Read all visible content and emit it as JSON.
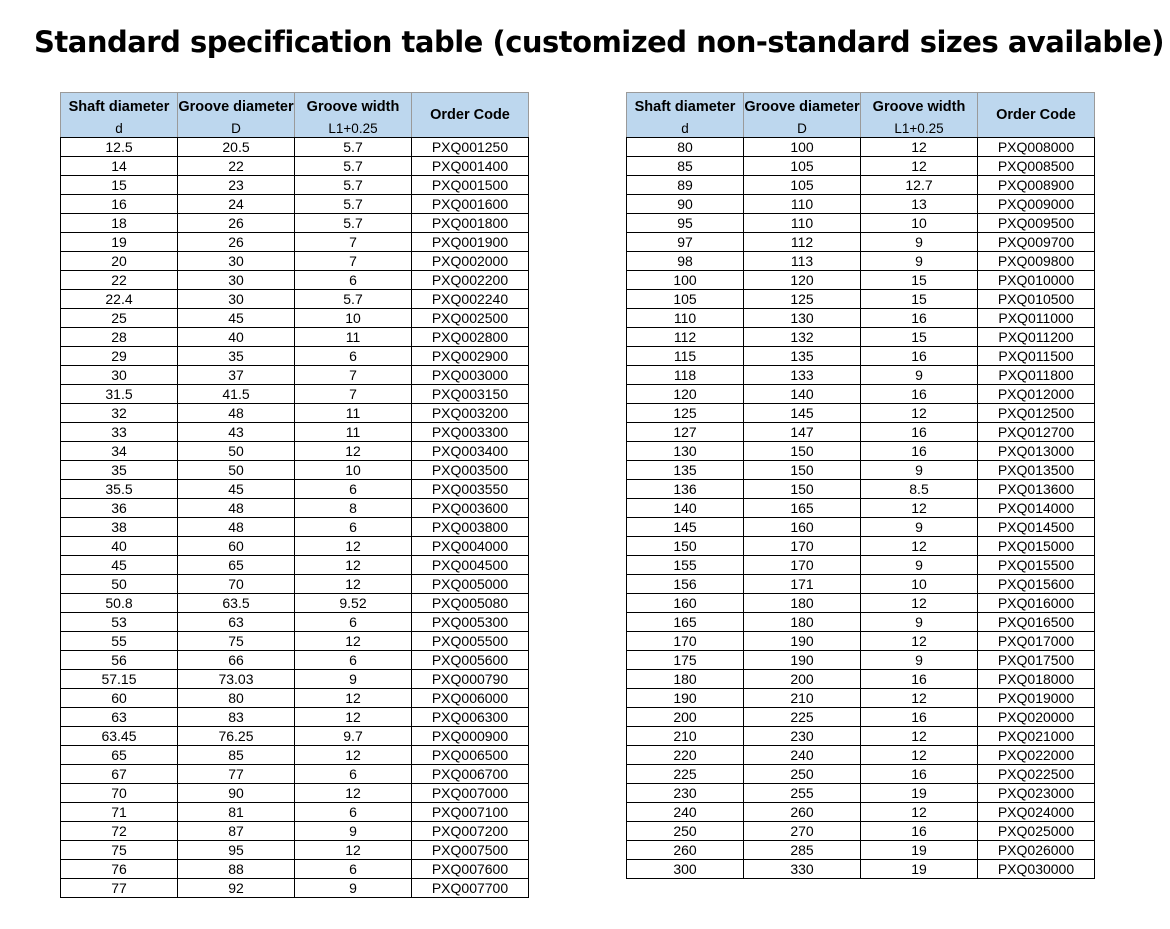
{
  "title": "Standard specification table (customized non-standard sizes available)",
  "headers": {
    "shaft": "Shaft diameter",
    "groove": "Groove diameter",
    "width": "Groove width",
    "code": "Order Code",
    "shaft_sub": "d",
    "groove_sub": "D",
    "width_sub": "L1+0.25"
  },
  "left_table": [
    [
      "12.5",
      "20.5",
      "5.7",
      "PXQ001250"
    ],
    [
      "14",
      "22",
      "5.7",
      "PXQ001400"
    ],
    [
      "15",
      "23",
      "5.7",
      "PXQ001500"
    ],
    [
      "16",
      "24",
      "5.7",
      "PXQ001600"
    ],
    [
      "18",
      "26",
      "5.7",
      "PXQ001800"
    ],
    [
      "19",
      "26",
      "7",
      "PXQ001900"
    ],
    [
      "20",
      "30",
      "7",
      "PXQ002000"
    ],
    [
      "22",
      "30",
      "6",
      "PXQ002200"
    ],
    [
      "22.4",
      "30",
      "5.7",
      "PXQ002240"
    ],
    [
      "25",
      "45",
      "10",
      "PXQ002500"
    ],
    [
      "28",
      "40",
      "11",
      "PXQ002800"
    ],
    [
      "29",
      "35",
      "6",
      "PXQ002900"
    ],
    [
      "30",
      "37",
      "7",
      "PXQ003000"
    ],
    [
      "31.5",
      "41.5",
      "7",
      "PXQ003150"
    ],
    [
      "32",
      "48",
      "11",
      "PXQ003200"
    ],
    [
      "33",
      "43",
      "11",
      "PXQ003300"
    ],
    [
      "34",
      "50",
      "12",
      "PXQ003400"
    ],
    [
      "35",
      "50",
      "10",
      "PXQ003500"
    ],
    [
      "35.5",
      "45",
      "6",
      "PXQ003550"
    ],
    [
      "36",
      "48",
      "8",
      "PXQ003600"
    ],
    [
      "38",
      "48",
      "6",
      "PXQ003800"
    ],
    [
      "40",
      "60",
      "12",
      "PXQ004000"
    ],
    [
      "45",
      "65",
      "12",
      "PXQ004500"
    ],
    [
      "50",
      "70",
      "12",
      "PXQ005000"
    ],
    [
      "50.8",
      "63.5",
      "9.52",
      "PXQ005080"
    ],
    [
      "53",
      "63",
      "6",
      "PXQ005300"
    ],
    [
      "55",
      "75",
      "12",
      "PXQ005500"
    ],
    [
      "56",
      "66",
      "6",
      "PXQ005600"
    ],
    [
      "57.15",
      "73.03",
      "9",
      "PXQ000790"
    ],
    [
      "60",
      "80",
      "12",
      "PXQ006000"
    ],
    [
      "63",
      "83",
      "12",
      "PXQ006300"
    ],
    [
      "63.45",
      "76.25",
      "9.7",
      "PXQ000900"
    ],
    [
      "65",
      "85",
      "12",
      "PXQ006500"
    ],
    [
      "67",
      "77",
      "6",
      "PXQ006700"
    ],
    [
      "70",
      "90",
      "12",
      "PXQ007000"
    ],
    [
      "71",
      "81",
      "6",
      "PXQ007100"
    ],
    [
      "72",
      "87",
      "9",
      "PXQ007200"
    ],
    [
      "75",
      "95",
      "12",
      "PXQ007500"
    ],
    [
      "76",
      "88",
      "6",
      "PXQ007600"
    ],
    [
      "77",
      "92",
      "9",
      "PXQ007700"
    ]
  ],
  "right_table": [
    [
      "80",
      "100",
      "12",
      "PXQ008000"
    ],
    [
      "85",
      "105",
      "12",
      "PXQ008500"
    ],
    [
      "89",
      "105",
      "12.7",
      "PXQ008900"
    ],
    [
      "90",
      "110",
      "13",
      "PXQ009000"
    ],
    [
      "95",
      "110",
      "10",
      "PXQ009500"
    ],
    [
      "97",
      "112",
      "9",
      "PXQ009700"
    ],
    [
      "98",
      "113",
      "9",
      "PXQ009800"
    ],
    [
      "100",
      "120",
      "15",
      "PXQ010000"
    ],
    [
      "105",
      "125",
      "15",
      "PXQ010500"
    ],
    [
      "110",
      "130",
      "16",
      "PXQ011000"
    ],
    [
      "112",
      "132",
      "15",
      "PXQ011200"
    ],
    [
      "115",
      "135",
      "16",
      "PXQ011500"
    ],
    [
      "118",
      "133",
      "9",
      "PXQ011800"
    ],
    [
      "120",
      "140",
      "16",
      "PXQ012000"
    ],
    [
      "125",
      "145",
      "12",
      "PXQ012500"
    ],
    [
      "127",
      "147",
      "16",
      "PXQ012700"
    ],
    [
      "130",
      "150",
      "16",
      "PXQ013000"
    ],
    [
      "135",
      "150",
      "9",
      "PXQ013500"
    ],
    [
      "136",
      "150",
      "8.5",
      "PXQ013600"
    ],
    [
      "140",
      "165",
      "12",
      "PXQ014000"
    ],
    [
      "145",
      "160",
      "9",
      "PXQ014500"
    ],
    [
      "150",
      "170",
      "12",
      "PXQ015000"
    ],
    [
      "155",
      "170",
      "9",
      "PXQ015500"
    ],
    [
      "156",
      "171",
      "10",
      "PXQ015600"
    ],
    [
      "160",
      "180",
      "12",
      "PXQ016000"
    ],
    [
      "165",
      "180",
      "9",
      "PXQ016500"
    ],
    [
      "170",
      "190",
      "12",
      "PXQ017000"
    ],
    [
      "175",
      "190",
      "9",
      "PXQ017500"
    ],
    [
      "180",
      "200",
      "16",
      "PXQ018000"
    ],
    [
      "190",
      "210",
      "12",
      "PXQ019000"
    ],
    [
      "200",
      "225",
      "16",
      "PXQ020000"
    ],
    [
      "210",
      "230",
      "12",
      "PXQ021000"
    ],
    [
      "220",
      "240",
      "12",
      "PXQ022000"
    ],
    [
      "225",
      "250",
      "16",
      "PXQ022500"
    ],
    [
      "230",
      "255",
      "19",
      "PXQ023000"
    ],
    [
      "240",
      "260",
      "12",
      "PXQ024000"
    ],
    [
      "250",
      "270",
      "16",
      "PXQ025000"
    ],
    [
      "260",
      "285",
      "19",
      "PXQ026000"
    ],
    [
      "300",
      "330",
      "19",
      "PXQ030000"
    ]
  ]
}
